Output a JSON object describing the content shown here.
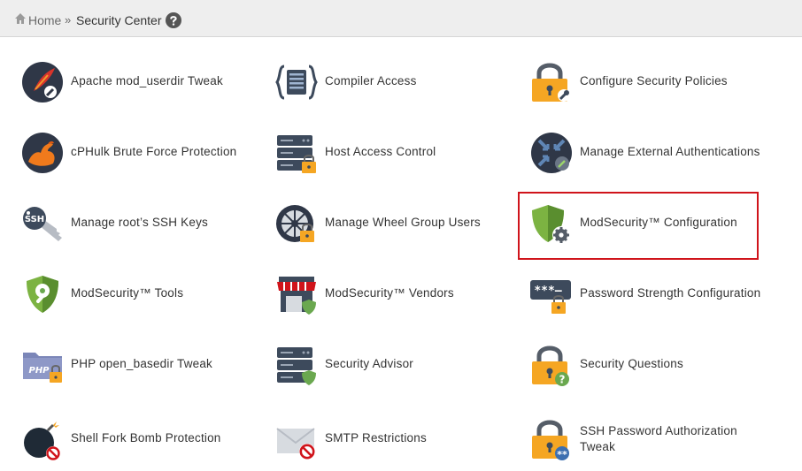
{
  "breadcrumb": {
    "home_label": "Home",
    "separator": "»",
    "current": "Security Center"
  },
  "tools": [
    {
      "label": "Apache mod_userdir Tweak",
      "icon": "feather-wrench-icon"
    },
    {
      "label": "Compiler Access",
      "icon": "code-braces-icon"
    },
    {
      "label": "Configure Security Policies",
      "icon": "padlock-wrench-icon"
    },
    {
      "label": "cPHulk Brute Force Protection",
      "icon": "flexed-arm-icon"
    },
    {
      "label": "Host Access Control",
      "icon": "server-lock-icon"
    },
    {
      "label": "Manage External Authentications",
      "icon": "external-auth-icon"
    },
    {
      "label": "Manage root’s SSH Keys",
      "icon": "ssh-key-icon"
    },
    {
      "label": "Manage Wheel Group Users",
      "icon": "wheel-lock-icon"
    },
    {
      "label": "ModSecurity™ Configuration",
      "icon": "shield-gear-icon"
    },
    {
      "label": "ModSecurity™ Tools",
      "icon": "shield-wrench-icon"
    },
    {
      "label": "ModSecurity™ Vendors",
      "icon": "storefront-shield-icon"
    },
    {
      "label": "Password Strength Configuration",
      "icon": "password-lock-icon"
    },
    {
      "label": "PHP open_basedir Tweak",
      "icon": "php-folder-lock-icon"
    },
    {
      "label": "Security Advisor",
      "icon": "server-shield-icon"
    },
    {
      "label": "Security Questions",
      "icon": "padlock-question-icon"
    },
    {
      "label": "Shell Fork Bomb Protection",
      "icon": "bomb-prohibited-icon"
    },
    {
      "label": "SMTP Restrictions",
      "icon": "envelope-prohibited-icon"
    },
    {
      "label": "SSH Password Authorization Tweak",
      "icon": "padlock-password-icon"
    }
  ],
  "highlighted_tool": "ModSecurity™ Configuration",
  "colors": {
    "highlight_border": "#d0141b",
    "breadcrumb_bg": "#eeeeee",
    "lock_yellow": "#f5a623",
    "icon_dark": "#3d4a5c",
    "shield_green": "#6aa84f"
  }
}
